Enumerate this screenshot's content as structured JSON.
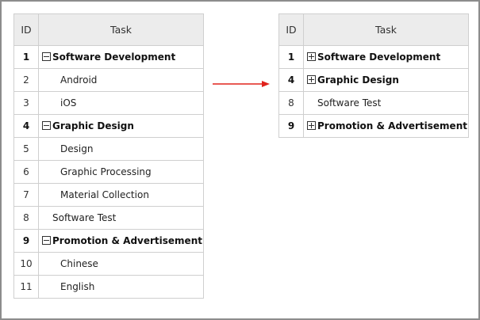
{
  "columns": {
    "id": "ID",
    "task": "Task"
  },
  "left_rows": [
    {
      "id": "1",
      "task": "Software Development",
      "level": "parent",
      "toggle": "minus"
    },
    {
      "id": "2",
      "task": "Android",
      "level": "child"
    },
    {
      "id": "3",
      "task": "iOS",
      "level": "child"
    },
    {
      "id": "4",
      "task": "Graphic Design",
      "level": "parent",
      "toggle": "minus"
    },
    {
      "id": "5",
      "task": "Design",
      "level": "child"
    },
    {
      "id": "6",
      "task": "Graphic Processing",
      "level": "child"
    },
    {
      "id": "7",
      "task": "Material Collection",
      "level": "child"
    },
    {
      "id": "8",
      "task": "Software Test",
      "level": "top"
    },
    {
      "id": "9",
      "task": "Promotion & Advertisement",
      "level": "parent",
      "toggle": "minus"
    },
    {
      "id": "10",
      "task": "Chinese",
      "level": "child"
    },
    {
      "id": "11",
      "task": "English",
      "level": "child"
    }
  ],
  "right_rows": [
    {
      "id": "1",
      "task": "Software Development",
      "level": "parent",
      "toggle": "plus"
    },
    {
      "id": "4",
      "task": "Graphic Design",
      "level": "parent",
      "toggle": "plus"
    },
    {
      "id": "8",
      "task": "Software Test",
      "level": "top"
    },
    {
      "id": "9",
      "task": "Promotion & Advertisement",
      "level": "parent",
      "toggle": "plus"
    }
  ],
  "colors": {
    "arrow": "#e0231c",
    "header_bg": "#ececec",
    "grid_line": "#cfcfcf",
    "frame": "#8c8c8c"
  },
  "icons": {
    "collapse": "minus-box-icon",
    "expand": "plus-box-icon",
    "arrow": "arrow-right-icon"
  }
}
